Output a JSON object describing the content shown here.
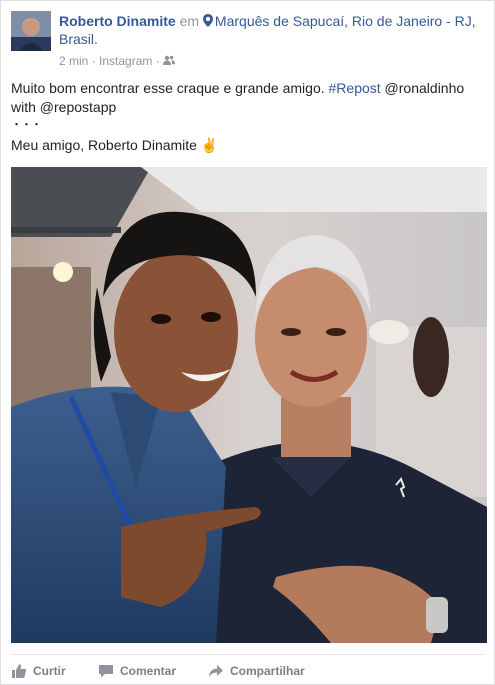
{
  "post": {
    "author": "Roberto Dinamite",
    "connector": "em",
    "location": "Marquês de Sapucaí, Rio de Janeiro - RJ, Brasil.",
    "timestamp": "2 min",
    "separator": "·",
    "source": "Instagram",
    "separator2": "·",
    "privacy_icon": "friends-icon",
    "text_line1_a": "Muito bom encontrar esse craque e grande amigo. ",
    "hashtag": "#Repost",
    "text_line1_b": " @ronaldinho with @repostapp",
    "text_dots": "・・・",
    "text_line2": "Meu amigo, Roberto Dinamite ✌️"
  },
  "actions": {
    "like": "Curtir",
    "comment": "Comentar",
    "share": "Compartilhar"
  },
  "colors": {
    "link": "#365899",
    "muted": "#90949c",
    "action": "#7f7f7f"
  }
}
